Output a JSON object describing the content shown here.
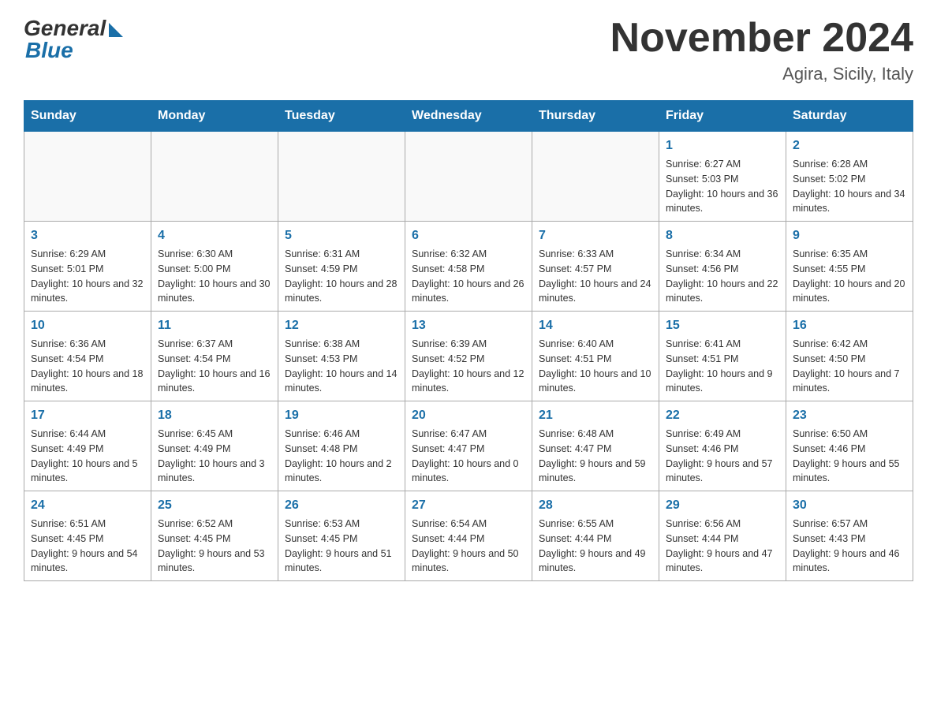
{
  "header": {
    "logo_general": "General",
    "logo_blue": "Blue",
    "month_year": "November 2024",
    "location": "Agira, Sicily, Italy"
  },
  "weekdays": [
    "Sunday",
    "Monday",
    "Tuesday",
    "Wednesday",
    "Thursday",
    "Friday",
    "Saturday"
  ],
  "weeks": [
    [
      {
        "day": "",
        "info": ""
      },
      {
        "day": "",
        "info": ""
      },
      {
        "day": "",
        "info": ""
      },
      {
        "day": "",
        "info": ""
      },
      {
        "day": "",
        "info": ""
      },
      {
        "day": "1",
        "info": "Sunrise: 6:27 AM\nSunset: 5:03 PM\nDaylight: 10 hours and 36 minutes."
      },
      {
        "day": "2",
        "info": "Sunrise: 6:28 AM\nSunset: 5:02 PM\nDaylight: 10 hours and 34 minutes."
      }
    ],
    [
      {
        "day": "3",
        "info": "Sunrise: 6:29 AM\nSunset: 5:01 PM\nDaylight: 10 hours and 32 minutes."
      },
      {
        "day": "4",
        "info": "Sunrise: 6:30 AM\nSunset: 5:00 PM\nDaylight: 10 hours and 30 minutes."
      },
      {
        "day": "5",
        "info": "Sunrise: 6:31 AM\nSunset: 4:59 PM\nDaylight: 10 hours and 28 minutes."
      },
      {
        "day": "6",
        "info": "Sunrise: 6:32 AM\nSunset: 4:58 PM\nDaylight: 10 hours and 26 minutes."
      },
      {
        "day": "7",
        "info": "Sunrise: 6:33 AM\nSunset: 4:57 PM\nDaylight: 10 hours and 24 minutes."
      },
      {
        "day": "8",
        "info": "Sunrise: 6:34 AM\nSunset: 4:56 PM\nDaylight: 10 hours and 22 minutes."
      },
      {
        "day": "9",
        "info": "Sunrise: 6:35 AM\nSunset: 4:55 PM\nDaylight: 10 hours and 20 minutes."
      }
    ],
    [
      {
        "day": "10",
        "info": "Sunrise: 6:36 AM\nSunset: 4:54 PM\nDaylight: 10 hours and 18 minutes."
      },
      {
        "day": "11",
        "info": "Sunrise: 6:37 AM\nSunset: 4:54 PM\nDaylight: 10 hours and 16 minutes."
      },
      {
        "day": "12",
        "info": "Sunrise: 6:38 AM\nSunset: 4:53 PM\nDaylight: 10 hours and 14 minutes."
      },
      {
        "day": "13",
        "info": "Sunrise: 6:39 AM\nSunset: 4:52 PM\nDaylight: 10 hours and 12 minutes."
      },
      {
        "day": "14",
        "info": "Sunrise: 6:40 AM\nSunset: 4:51 PM\nDaylight: 10 hours and 10 minutes."
      },
      {
        "day": "15",
        "info": "Sunrise: 6:41 AM\nSunset: 4:51 PM\nDaylight: 10 hours and 9 minutes."
      },
      {
        "day": "16",
        "info": "Sunrise: 6:42 AM\nSunset: 4:50 PM\nDaylight: 10 hours and 7 minutes."
      }
    ],
    [
      {
        "day": "17",
        "info": "Sunrise: 6:44 AM\nSunset: 4:49 PM\nDaylight: 10 hours and 5 minutes."
      },
      {
        "day": "18",
        "info": "Sunrise: 6:45 AM\nSunset: 4:49 PM\nDaylight: 10 hours and 3 minutes."
      },
      {
        "day": "19",
        "info": "Sunrise: 6:46 AM\nSunset: 4:48 PM\nDaylight: 10 hours and 2 minutes."
      },
      {
        "day": "20",
        "info": "Sunrise: 6:47 AM\nSunset: 4:47 PM\nDaylight: 10 hours and 0 minutes."
      },
      {
        "day": "21",
        "info": "Sunrise: 6:48 AM\nSunset: 4:47 PM\nDaylight: 9 hours and 59 minutes."
      },
      {
        "day": "22",
        "info": "Sunrise: 6:49 AM\nSunset: 4:46 PM\nDaylight: 9 hours and 57 minutes."
      },
      {
        "day": "23",
        "info": "Sunrise: 6:50 AM\nSunset: 4:46 PM\nDaylight: 9 hours and 55 minutes."
      }
    ],
    [
      {
        "day": "24",
        "info": "Sunrise: 6:51 AM\nSunset: 4:45 PM\nDaylight: 9 hours and 54 minutes."
      },
      {
        "day": "25",
        "info": "Sunrise: 6:52 AM\nSunset: 4:45 PM\nDaylight: 9 hours and 53 minutes."
      },
      {
        "day": "26",
        "info": "Sunrise: 6:53 AM\nSunset: 4:45 PM\nDaylight: 9 hours and 51 minutes."
      },
      {
        "day": "27",
        "info": "Sunrise: 6:54 AM\nSunset: 4:44 PM\nDaylight: 9 hours and 50 minutes."
      },
      {
        "day": "28",
        "info": "Sunrise: 6:55 AM\nSunset: 4:44 PM\nDaylight: 9 hours and 49 minutes."
      },
      {
        "day": "29",
        "info": "Sunrise: 6:56 AM\nSunset: 4:44 PM\nDaylight: 9 hours and 47 minutes."
      },
      {
        "day": "30",
        "info": "Sunrise: 6:57 AM\nSunset: 4:43 PM\nDaylight: 9 hours and 46 minutes."
      }
    ]
  ]
}
